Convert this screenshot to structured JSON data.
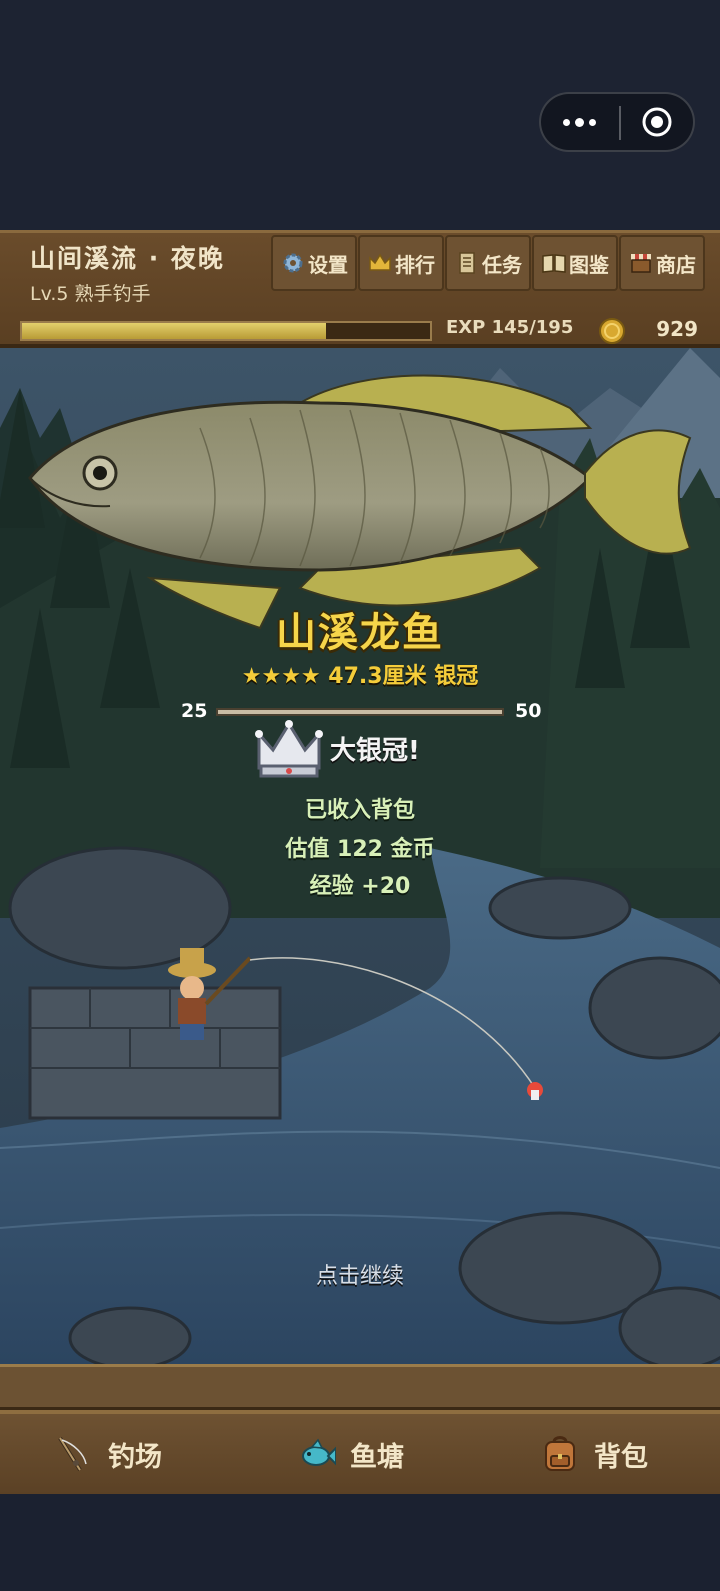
{
  "header": {
    "scene_title": "山间溪流 · 夜晚",
    "level": "Lv.5 熟手钓手",
    "exp_text": "EXP 145/195",
    "exp_progress": 0.744,
    "coins": "929",
    "menu": [
      {
        "label": "设置",
        "icon": "gear-icon"
      },
      {
        "label": "排行",
        "icon": "crown-icon"
      },
      {
        "label": "任务",
        "icon": "scroll-icon"
      },
      {
        "label": "图鉴",
        "icon": "book-icon"
      },
      {
        "label": "商店",
        "icon": "shop-icon"
      }
    ]
  },
  "catch": {
    "fish_name": "山溪龙鱼",
    "stars_text": "★★★★ 47.3厘米 银冠",
    "scale_min": "25",
    "scale_max": "50",
    "crown_label": "大银冠!",
    "stored": "已收入背包",
    "value": "估值 122 金币",
    "exp": "经验 +20",
    "continue": "点击继续"
  },
  "tabs": [
    {
      "label": "钓场",
      "icon": "fishing-rod-icon"
    },
    {
      "label": "鱼塘",
      "icon": "fish-icon"
    },
    {
      "label": "背包",
      "icon": "backpack-icon"
    }
  ],
  "colors": {
    "header_wood": "#6a4c2b",
    "exp_fill": "#d9c35c",
    "fish_name": "#f6d54a",
    "result_text": "#d8f0b8"
  }
}
